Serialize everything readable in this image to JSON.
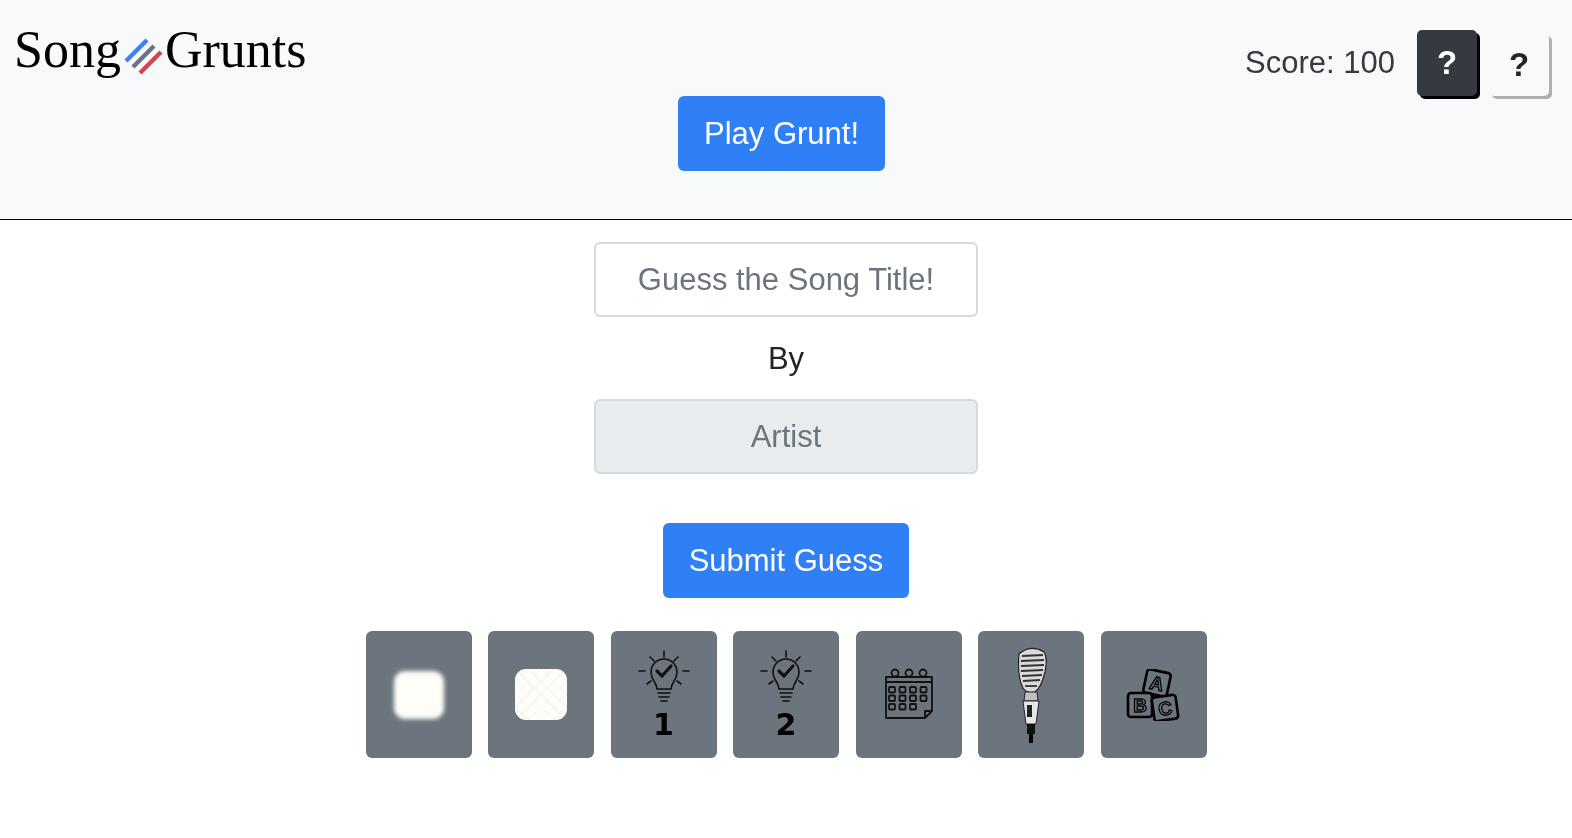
{
  "header": {
    "logo": {
      "left": "Song",
      "right": "Grunts"
    },
    "score": "Score: 100",
    "help_buttons": [
      {
        "label": "?",
        "kind": "dark"
      },
      {
        "label": "?",
        "kind": "light"
      }
    ],
    "play_button": "Play Grunt!"
  },
  "guess_form": {
    "title_field": {
      "placeholder": "Guess the Song Title!",
      "disabled": false
    },
    "by_label": "By",
    "artist_field": {
      "placeholder": "Artist",
      "disabled": true
    },
    "submit_button": "Submit Guess"
  },
  "hint_buttons": [
    {
      "kind": "blur"
    },
    {
      "kind": "tile"
    },
    {
      "kind": "bulb",
      "label": "1"
    },
    {
      "kind": "bulb",
      "label": "2"
    },
    {
      "kind": "calendar"
    },
    {
      "kind": "microphone"
    },
    {
      "kind": "blocks",
      "letters": [
        "A",
        "B",
        "C"
      ]
    }
  ]
}
